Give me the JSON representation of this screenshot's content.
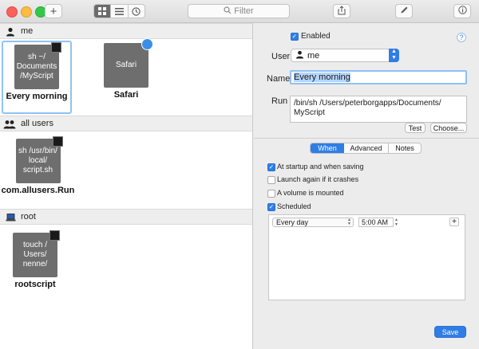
{
  "toolbar": {
    "add_label": "+",
    "filter_placeholder": "Filter",
    "view_icons": [
      "grid-icon",
      "list-icon",
      "clock-icon"
    ]
  },
  "sections": [
    {
      "title": "me",
      "icon": "user-icon"
    },
    {
      "title": "all users",
      "icon": "users-icon"
    },
    {
      "title": "root",
      "icon": "laptop-icon"
    }
  ],
  "scripts": {
    "me": [
      {
        "thumb": "sh ~/ Documents /MyScript",
        "label": "Every morning"
      },
      {
        "thumb": "Safari",
        "label": "Safari"
      }
    ],
    "all_users": [
      {
        "thumb": "sh /usr/bin/ local/ script.sh",
        "label": "com.allusers.Run"
      }
    ],
    "root": [
      {
        "thumb": "touch / Users/ nenne/",
        "label": "rootscript"
      }
    ]
  },
  "detail": {
    "enabled_label": "Enabled",
    "help_label": "?",
    "user_label": "User",
    "user_value": "me",
    "name_label": "Name",
    "name_value": "Every morning",
    "run_label": "Run",
    "run_value": "/bin/sh /Users/peterborgapps/Documents/ MyScript",
    "test_label": "Test",
    "choose_label": "Choose...",
    "tabs": [
      "When",
      "Advanced",
      "Notes"
    ],
    "options": [
      {
        "label": "At startup and when saving",
        "checked": true
      },
      {
        "label": "Launch again if it crashes",
        "checked": false
      },
      {
        "label": "A volume is mounted",
        "checked": false
      },
      {
        "label": "Scheduled",
        "checked": true
      }
    ],
    "schedule_value": "Every day",
    "time_value": "5:00 AM",
    "add_schedule_label": "+",
    "save_label": "Save"
  },
  "colors": {
    "accent": "#2f7ee6",
    "thumb": "#6e6e6e"
  }
}
